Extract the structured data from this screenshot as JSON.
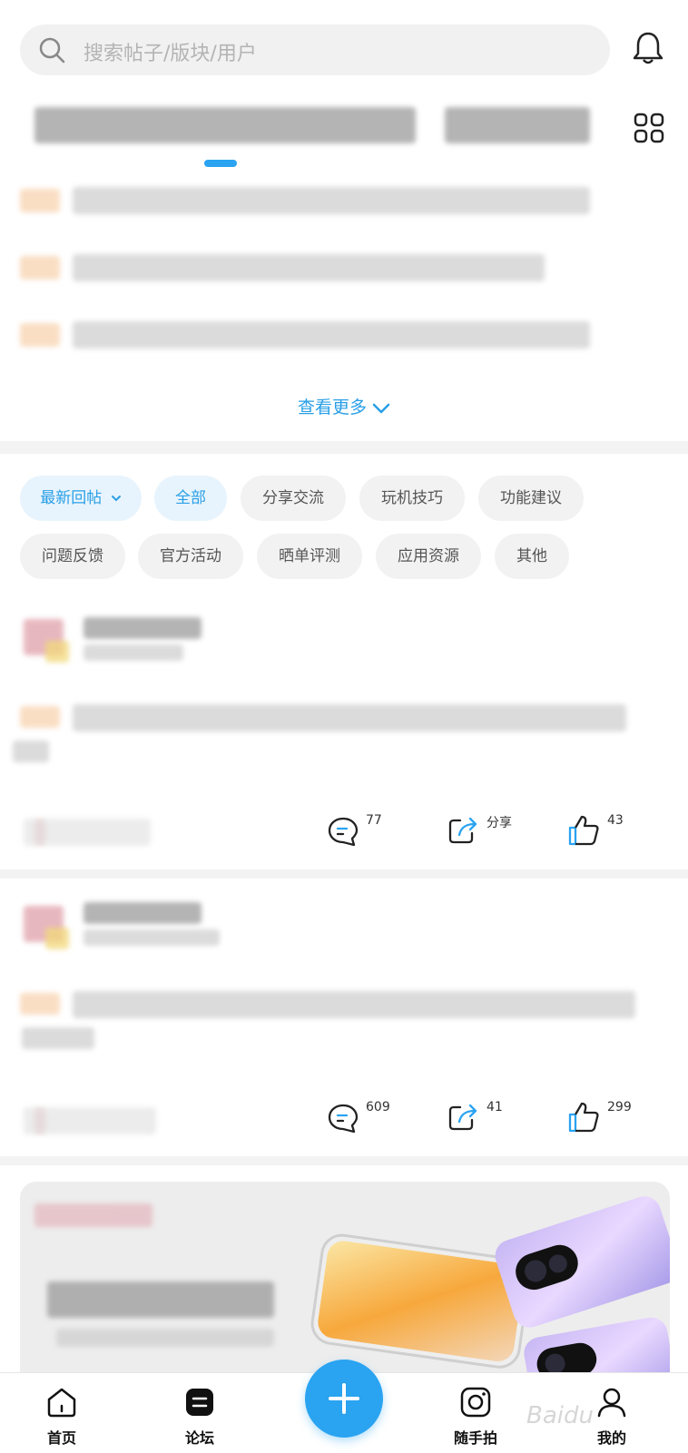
{
  "search": {
    "placeholder": "搜索帖子/版块/用户"
  },
  "see_more": "查看更多",
  "filters": {
    "sort_label": "最新回帖",
    "chips": [
      "全部",
      "分享交流",
      "玩机技巧",
      "功能建议",
      "问题反馈",
      "官方活动",
      "晒单评测",
      "应用资源",
      "其他"
    ],
    "active_chip": "全部"
  },
  "posts": [
    {
      "comments": "77",
      "share": "分享",
      "likes": "43"
    },
    {
      "comments": "609",
      "share": "41",
      "likes": "299"
    }
  ],
  "tabbar": {
    "home": "首页",
    "forum": "论坛",
    "snap": "随手拍",
    "mine": "我的"
  },
  "watermark": "Baidu",
  "colors": {
    "accent": "#2aa3f1",
    "chip_bg": "#f2f2f2",
    "active_chip_bg": "#e8f4fd"
  }
}
